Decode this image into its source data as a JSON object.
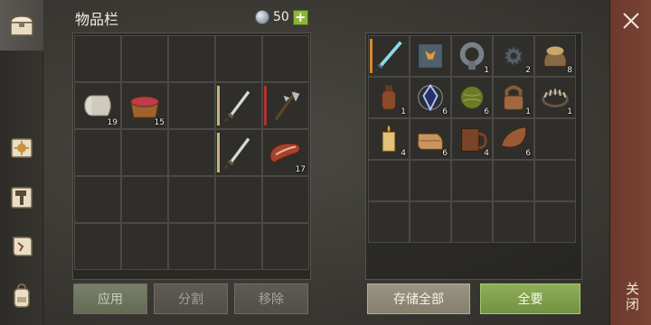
{
  "header": {
    "title": "物品栏",
    "currency_amount": "50",
    "plus_label": "+"
  },
  "close": {
    "label": "关闭"
  },
  "tabs": [
    "chest-icon",
    "sun-scroll-icon",
    "hammer-icon",
    "map-scroll-icon",
    "backpack-icon"
  ],
  "inventory": {
    "rows": [
      [
        null,
        null,
        null,
        null,
        null
      ],
      [
        {
          "icon": "cloth-roll-icon",
          "qty": "19"
        },
        {
          "icon": "berry-bowl-icon",
          "qty": "15"
        },
        null,
        {
          "icon": "sword-icon",
          "qty": "",
          "bar": "#c9b07a"
        },
        {
          "icon": "halberd-icon",
          "qty": "",
          "bar": "#b03030"
        }
      ],
      [
        null,
        null,
        null,
        {
          "icon": "sword-icon",
          "qty": "",
          "bar": "#c9b07a"
        },
        {
          "icon": "meat-icon",
          "qty": "17"
        }
      ],
      [
        null,
        null,
        null,
        null,
        null
      ],
      [
        null,
        null,
        null,
        null,
        null
      ]
    ],
    "buttons": {
      "apply": "应用",
      "split": "分割",
      "remove": "移除"
    }
  },
  "storage": {
    "rows": [
      [
        {
          "icon": "ice-sword-icon",
          "qty": "",
          "bar": "#d98a2a"
        },
        {
          "icon": "book-icon",
          "qty": ""
        },
        {
          "icon": "pipe-icon",
          "qty": "1"
        },
        {
          "icon": "gear-icon",
          "qty": "2"
        },
        {
          "icon": "seed-sack-icon",
          "qty": "8"
        }
      ],
      [
        {
          "icon": "flask-icon",
          "qty": "1"
        },
        {
          "icon": "crystal-icon",
          "qty": "6"
        },
        {
          "icon": "herb-ball-icon",
          "qty": "6"
        },
        {
          "icon": "padlock-icon",
          "qty": "1"
        },
        {
          "icon": "trap-icon",
          "qty": "1"
        }
      ],
      [
        {
          "icon": "candle-icon",
          "qty": "4"
        },
        {
          "icon": "leather-icon",
          "qty": "6"
        },
        {
          "icon": "mug-icon",
          "qty": "4"
        },
        {
          "icon": "hide-icon",
          "qty": "6"
        },
        null
      ],
      [
        null,
        null,
        null,
        null,
        null
      ],
      [
        null,
        null,
        null,
        null,
        null
      ]
    ],
    "buttons": {
      "store_all": "存储全部",
      "take_all": "全要"
    }
  },
  "colors": {
    "accent_green": "#8bb53a",
    "close_bar": "#7b4333"
  }
}
